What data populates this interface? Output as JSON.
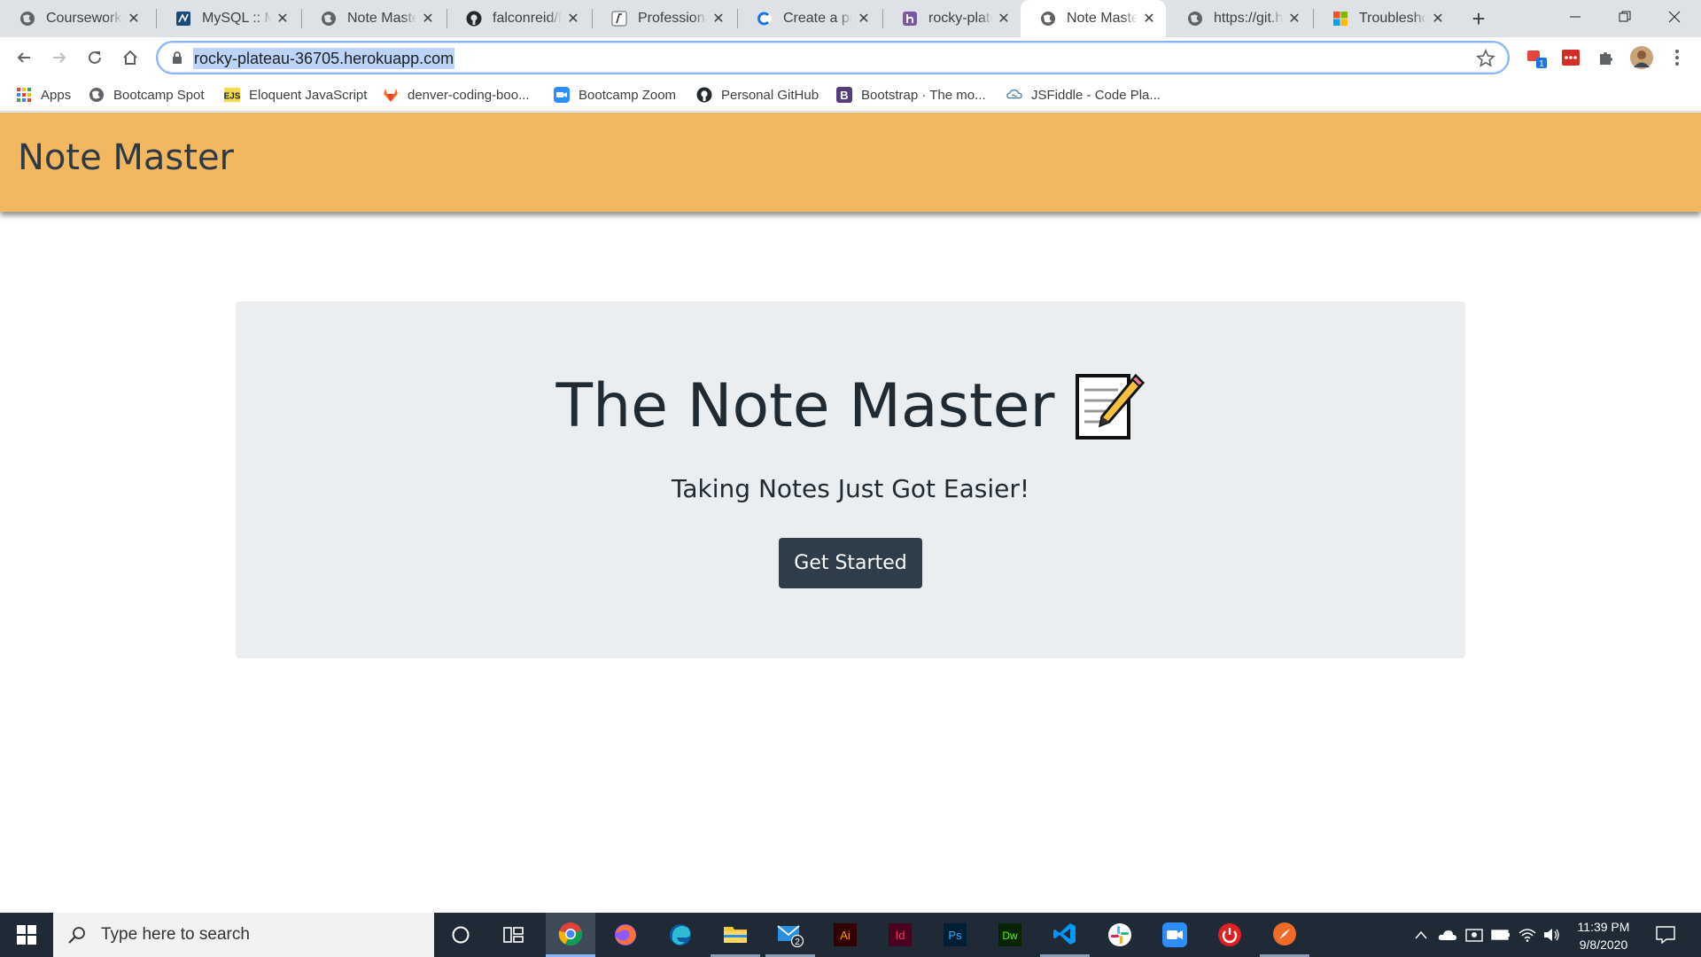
{
  "browser": {
    "tabs": [
      {
        "title": "Coursework",
        "icon": "globe-icon"
      },
      {
        "title": "MySQL :: My",
        "icon": "mysql-icon"
      },
      {
        "title": "Note Master",
        "icon": "globe-icon"
      },
      {
        "title": "falconreid/N",
        "icon": "github-icon"
      },
      {
        "title": "Professional",
        "icon": "professional-icon"
      },
      {
        "title": "Create a pal",
        "icon": "create-icon"
      },
      {
        "title": "rocky-plate",
        "icon": "heroku-icon"
      },
      {
        "title": "Note Master",
        "icon": "globe-icon",
        "active": true
      },
      {
        "title": "https://git.h",
        "icon": "globe-icon"
      },
      {
        "title": "Troubleshoo",
        "icon": "microsoft-icon"
      }
    ],
    "address": "rocky-plateau-36705.herokuapp.com",
    "extension_badge": "1",
    "bookmarks": [
      {
        "label": "Apps",
        "icon": "apps-grid-icon"
      },
      {
        "label": "Bootcamp Spot",
        "icon": "globe-icon"
      },
      {
        "label": "Eloquent JavaScript",
        "icon": "ejs-icon"
      },
      {
        "label": "denver-coding-boo...",
        "icon": "gitlab-icon"
      },
      {
        "label": "Bootcamp Zoom",
        "icon": "zoom-icon"
      },
      {
        "label": "Personal GitHub",
        "icon": "github-icon"
      },
      {
        "label": "Bootstrap · The mo...",
        "icon": "bootstrap-icon"
      },
      {
        "label": "JSFiddle - Code Pla...",
        "icon": "jsfiddle-icon"
      }
    ]
  },
  "page": {
    "brand": "Note Master",
    "heading": "The Note Master",
    "heading_icon": "memo-icon",
    "tagline": "Taking Notes Just Got Easier!",
    "cta_label": "Get Started",
    "colors": {
      "navbar": "#f3b760",
      "jumbotron": "#ebeef0",
      "button": "#2f3c49"
    }
  },
  "taskbar": {
    "search_placeholder": "Type here to search",
    "mail_badge": "2",
    "time": "11:39 PM",
    "date": "9/8/2020"
  }
}
